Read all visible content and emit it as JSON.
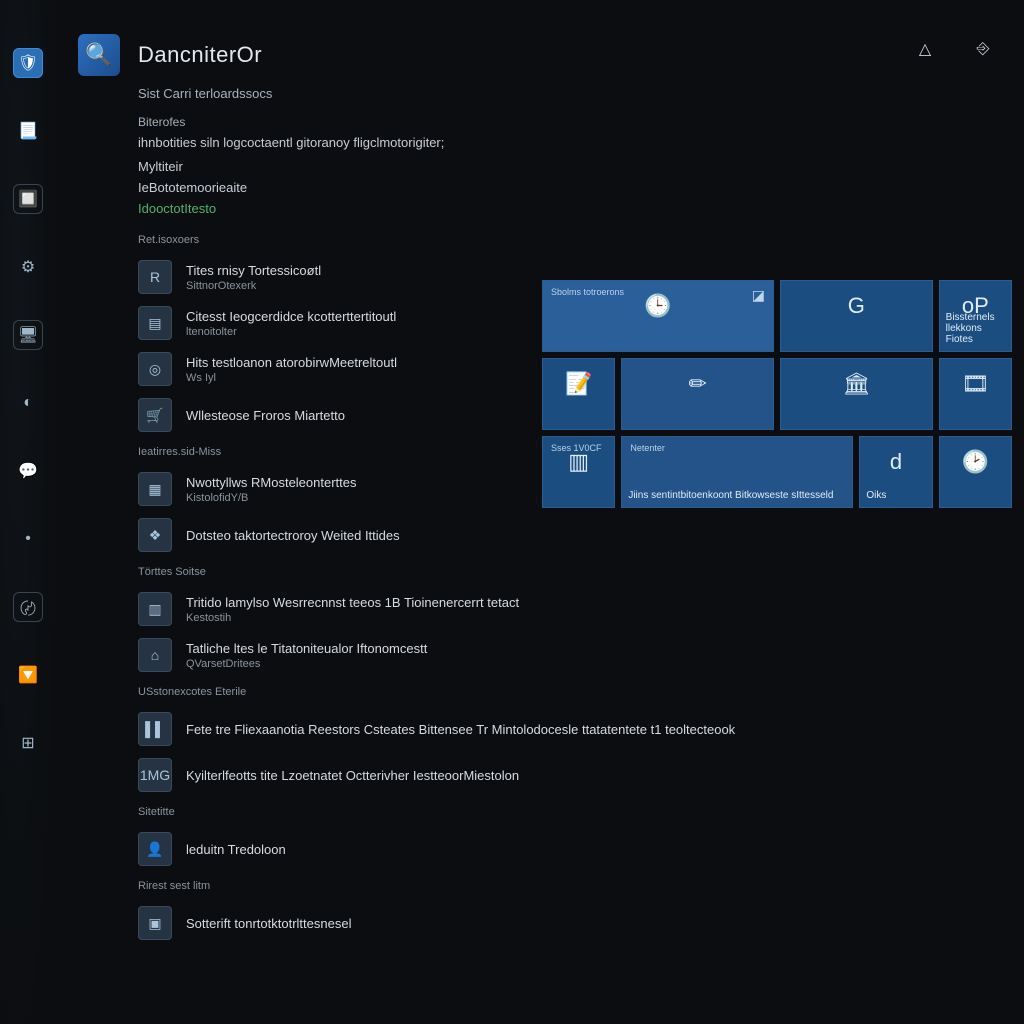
{
  "header": {
    "title": "DancniterOr",
    "subtitle": "Sist   Carri  terloardssocs"
  },
  "intro": {
    "section_label": "Biterofes",
    "description": "ihnbotities siln logcoctaentl gitoranoy fligclmotorigiter;",
    "line2": "Myltiteir",
    "line3": "IeBototemoorieaite",
    "link": "IdooctotItesto"
  },
  "groups": [
    {
      "label": "Ret.isoxoers",
      "items": [
        {
          "icon": "R",
          "title": "Tites rnisy Tortessicoøtl",
          "sub": "SittnorOtexerk"
        },
        {
          "icon": "▤",
          "title": "Citesst Ieogcerdidce kcotterttertitoutl",
          "sub": "ltenoitolter"
        },
        {
          "icon": "◎",
          "title": "Hits testloanon atorobirwMeetreltoutl",
          "sub": "Ws Iyl"
        },
        {
          "icon": "🛒",
          "title": "Wllesteose Froros Miartetto"
        }
      ]
    },
    {
      "label": "Ieatirres.sid-Miss",
      "items": [
        {
          "icon": "▦",
          "title": "Nwottyllws RMosteleonterttes",
          "sub": "KistolofidY/B"
        },
        {
          "icon": "❖",
          "title": "Dotsteo taktortectroroy Weited Ittides"
        }
      ]
    },
    {
      "label": "Törttes Soitse",
      "items": [
        {
          "icon": "▥",
          "title": "Tritido lamylso Wesrrecnnst teeos 1B Tioinenercerrt tetact",
          "sub": "Kestostih"
        },
        {
          "icon": "⌂",
          "title": "Tatliche ltes le Titatoniteualor Iftonomcestt",
          "sub": "QVarsetDritees"
        }
      ]
    },
    {
      "label": "USstonexcotes Eterile",
      "items": [
        {
          "icon": "▌▌",
          "title": "Fete tre Fliexaanotia Reestors   Csteates Bittensee Tr Mintolodocesle ttatatentete t1 teoltecteook"
        },
        {
          "icon": "1MG",
          "title": "Kyilterlfeotts tite Lzoetnatet  Octterivher IestteoorMiestolon"
        }
      ]
    },
    {
      "label": "Sitetitte",
      "items": [
        {
          "icon": "👤",
          "title": "leduitn Tredoloon"
        }
      ]
    },
    {
      "label": "Rirest sest litm",
      "items": [
        {
          "icon": "▣",
          "title": "Sotterift tonrtotktotrlttesnesel"
        }
      ]
    }
  ],
  "tiles": [
    {
      "shape": "big light",
      "top": "Sbolms totroerons",
      "icon": "🕒",
      "label": "",
      "corner": "◪"
    },
    {
      "shape": "wide2",
      "icon": "G",
      "label": ""
    },
    {
      "shape": "sm",
      "icon": "oP",
      "label": "Bissternels llekkons\nFiotes"
    },
    {
      "shape": "sm",
      "icon": "📝",
      "label": ""
    },
    {
      "shape": "wide2 alt",
      "icon": "✏",
      "label": ""
    },
    {
      "shape": "wide2",
      "icon": "🏛",
      "label": ""
    },
    {
      "shape": "sm",
      "icon": "🎞",
      "label": ""
    },
    {
      "shape": "sm",
      "top": "Sses\n1V0CF",
      "icon": "▥",
      "label": ""
    },
    {
      "shape": "big alt",
      "top": "Netenter",
      "label": "Jiins sentintbitoenkoont\nBitkowseste\nsIttesseld"
    },
    {
      "shape": "sm",
      "icon": "d",
      "label": "Oiks"
    },
    {
      "shape": "sm",
      "icon": "🕑",
      "label": ""
    }
  ],
  "top_actions": {
    "notify": "△",
    "exit": "⎆"
  },
  "rail": [
    "🛡",
    "📃",
    "🔲",
    "⚙",
    "🖥",
    "◐",
    "💬",
    "•",
    "〄",
    "🔽",
    "⊞"
  ]
}
